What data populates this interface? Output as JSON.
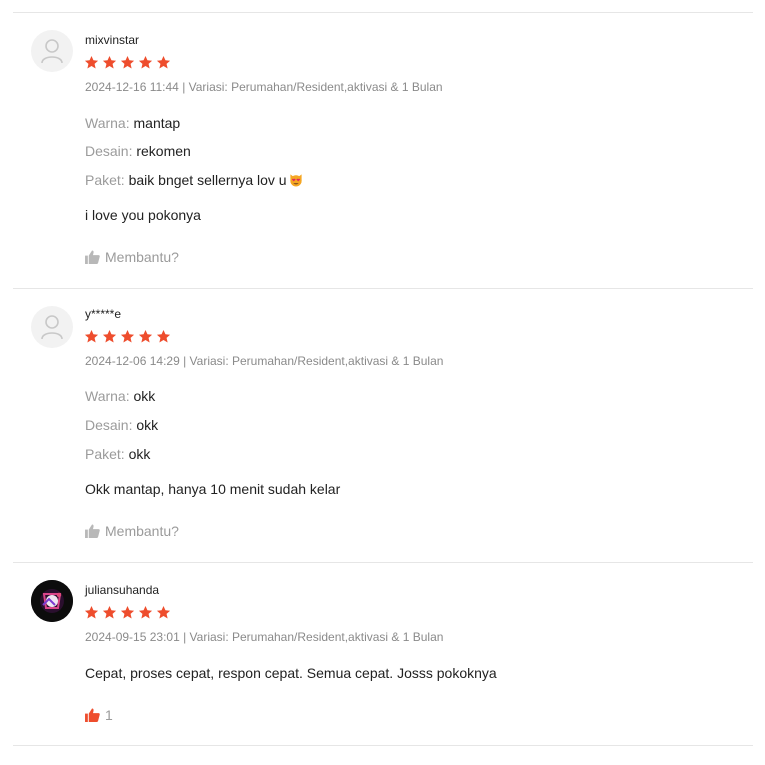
{
  "reviews": [
    {
      "username": "mixvinstar",
      "rating": 5,
      "meta": "2024-12-16 11:44 | Variasi: Perumahan/Resident,aktivasi & 1 Bulan",
      "attrs": [
        {
          "key": "Warna:",
          "value": "mantap"
        },
        {
          "key": "Desain:",
          "value": "rekomen"
        },
        {
          "key": "Paket:",
          "value": "baik bnget sellernya lov u"
        }
      ],
      "comment": "i love you pokonya",
      "helpful_label": "Membantu?"
    },
    {
      "username": "y*****e",
      "rating": 5,
      "meta": "2024-12-06 14:29 | Variasi: Perumahan/Resident,aktivasi & 1 Bulan",
      "attrs": [
        {
          "key": "Warna:",
          "value": "okk"
        },
        {
          "key": "Desain:",
          "value": "okk"
        },
        {
          "key": "Paket:",
          "value": "okk"
        }
      ],
      "comment": "Okk mantap, hanya 10 menit sudah kelar",
      "helpful_label": "Membantu?"
    },
    {
      "username": "juliansuhanda",
      "rating": 5,
      "meta": "2024-09-15 23:01 | Variasi: Perumahan/Resident,aktivasi & 1 Bulan",
      "attrs": [],
      "comment": "Cepat, proses cepat, respon cepat. Semua cepat. Josss pokoknya",
      "helpful_label": "1"
    }
  ],
  "icons": {
    "star": "star-icon",
    "thumb": "thumbs-up-icon",
    "avatar_placeholder": "user-icon",
    "emoji": "cat-heart-eyes-emoji"
  },
  "colors": {
    "star": "#ee4d2d",
    "helpful_active": "#ee4d2d",
    "muted": "#9b9b9b",
    "divider": "#e6e6e6"
  }
}
